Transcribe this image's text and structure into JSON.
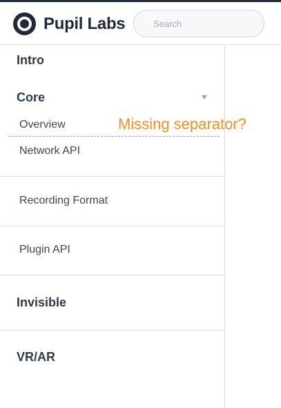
{
  "header": {
    "logo_text": "Pupil Labs",
    "search_placeholder": "Search"
  },
  "sidebar": {
    "sections": [
      {
        "title": "Intro"
      },
      {
        "title": "Core",
        "expanded": true,
        "items": [
          "Overview",
          "Network API",
          "Recording Format",
          "Plugin API"
        ]
      },
      {
        "title": "Invisible"
      },
      {
        "title": "VR/AR"
      }
    ]
  },
  "annotation": {
    "text": "Missing separator?",
    "color": "#f5901f"
  }
}
